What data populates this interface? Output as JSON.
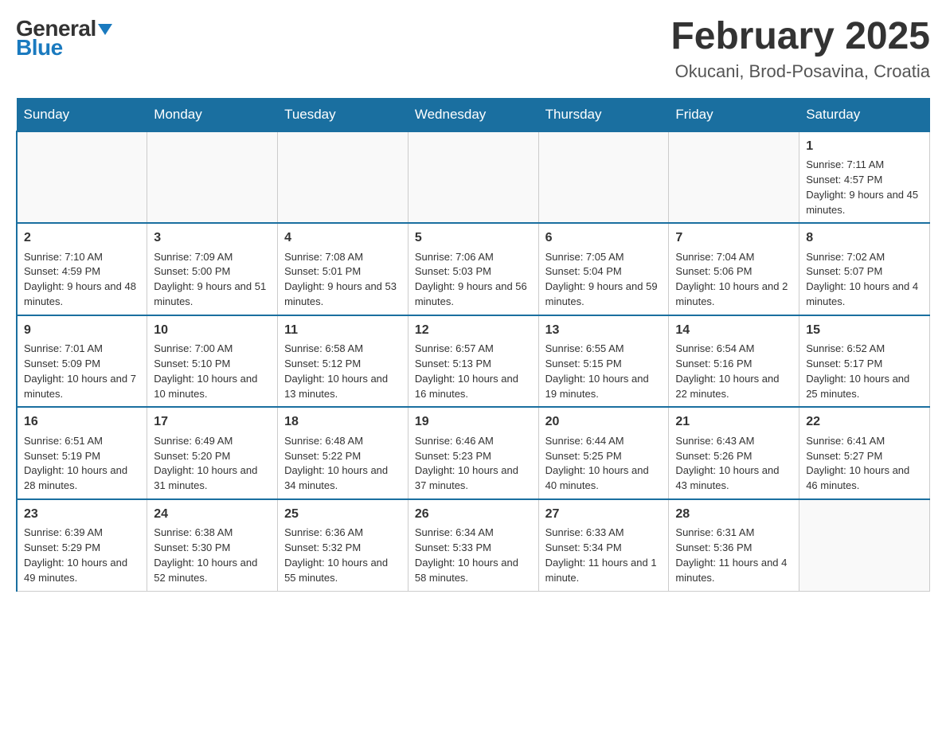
{
  "header": {
    "logo_general": "General",
    "logo_blue": "Blue",
    "month_title": "February 2025",
    "location": "Okucani, Brod-Posavina, Croatia"
  },
  "days_of_week": [
    "Sunday",
    "Monday",
    "Tuesday",
    "Wednesday",
    "Thursday",
    "Friday",
    "Saturday"
  ],
  "weeks": [
    [
      {
        "day": "",
        "info": ""
      },
      {
        "day": "",
        "info": ""
      },
      {
        "day": "",
        "info": ""
      },
      {
        "day": "",
        "info": ""
      },
      {
        "day": "",
        "info": ""
      },
      {
        "day": "",
        "info": ""
      },
      {
        "day": "1",
        "info": "Sunrise: 7:11 AM\nSunset: 4:57 PM\nDaylight: 9 hours and 45 minutes."
      }
    ],
    [
      {
        "day": "2",
        "info": "Sunrise: 7:10 AM\nSunset: 4:59 PM\nDaylight: 9 hours and 48 minutes."
      },
      {
        "day": "3",
        "info": "Sunrise: 7:09 AM\nSunset: 5:00 PM\nDaylight: 9 hours and 51 minutes."
      },
      {
        "day": "4",
        "info": "Sunrise: 7:08 AM\nSunset: 5:01 PM\nDaylight: 9 hours and 53 minutes."
      },
      {
        "day": "5",
        "info": "Sunrise: 7:06 AM\nSunset: 5:03 PM\nDaylight: 9 hours and 56 minutes."
      },
      {
        "day": "6",
        "info": "Sunrise: 7:05 AM\nSunset: 5:04 PM\nDaylight: 9 hours and 59 minutes."
      },
      {
        "day": "7",
        "info": "Sunrise: 7:04 AM\nSunset: 5:06 PM\nDaylight: 10 hours and 2 minutes."
      },
      {
        "day": "8",
        "info": "Sunrise: 7:02 AM\nSunset: 5:07 PM\nDaylight: 10 hours and 4 minutes."
      }
    ],
    [
      {
        "day": "9",
        "info": "Sunrise: 7:01 AM\nSunset: 5:09 PM\nDaylight: 10 hours and 7 minutes."
      },
      {
        "day": "10",
        "info": "Sunrise: 7:00 AM\nSunset: 5:10 PM\nDaylight: 10 hours and 10 minutes."
      },
      {
        "day": "11",
        "info": "Sunrise: 6:58 AM\nSunset: 5:12 PM\nDaylight: 10 hours and 13 minutes."
      },
      {
        "day": "12",
        "info": "Sunrise: 6:57 AM\nSunset: 5:13 PM\nDaylight: 10 hours and 16 minutes."
      },
      {
        "day": "13",
        "info": "Sunrise: 6:55 AM\nSunset: 5:15 PM\nDaylight: 10 hours and 19 minutes."
      },
      {
        "day": "14",
        "info": "Sunrise: 6:54 AM\nSunset: 5:16 PM\nDaylight: 10 hours and 22 minutes."
      },
      {
        "day": "15",
        "info": "Sunrise: 6:52 AM\nSunset: 5:17 PM\nDaylight: 10 hours and 25 minutes."
      }
    ],
    [
      {
        "day": "16",
        "info": "Sunrise: 6:51 AM\nSunset: 5:19 PM\nDaylight: 10 hours and 28 minutes."
      },
      {
        "day": "17",
        "info": "Sunrise: 6:49 AM\nSunset: 5:20 PM\nDaylight: 10 hours and 31 minutes."
      },
      {
        "day": "18",
        "info": "Sunrise: 6:48 AM\nSunset: 5:22 PM\nDaylight: 10 hours and 34 minutes."
      },
      {
        "day": "19",
        "info": "Sunrise: 6:46 AM\nSunset: 5:23 PM\nDaylight: 10 hours and 37 minutes."
      },
      {
        "day": "20",
        "info": "Sunrise: 6:44 AM\nSunset: 5:25 PM\nDaylight: 10 hours and 40 minutes."
      },
      {
        "day": "21",
        "info": "Sunrise: 6:43 AM\nSunset: 5:26 PM\nDaylight: 10 hours and 43 minutes."
      },
      {
        "day": "22",
        "info": "Sunrise: 6:41 AM\nSunset: 5:27 PM\nDaylight: 10 hours and 46 minutes."
      }
    ],
    [
      {
        "day": "23",
        "info": "Sunrise: 6:39 AM\nSunset: 5:29 PM\nDaylight: 10 hours and 49 minutes."
      },
      {
        "day": "24",
        "info": "Sunrise: 6:38 AM\nSunset: 5:30 PM\nDaylight: 10 hours and 52 minutes."
      },
      {
        "day": "25",
        "info": "Sunrise: 6:36 AM\nSunset: 5:32 PM\nDaylight: 10 hours and 55 minutes."
      },
      {
        "day": "26",
        "info": "Sunrise: 6:34 AM\nSunset: 5:33 PM\nDaylight: 10 hours and 58 minutes."
      },
      {
        "day": "27",
        "info": "Sunrise: 6:33 AM\nSunset: 5:34 PM\nDaylight: 11 hours and 1 minute."
      },
      {
        "day": "28",
        "info": "Sunrise: 6:31 AM\nSunset: 5:36 PM\nDaylight: 11 hours and 4 minutes."
      },
      {
        "day": "",
        "info": ""
      }
    ]
  ]
}
